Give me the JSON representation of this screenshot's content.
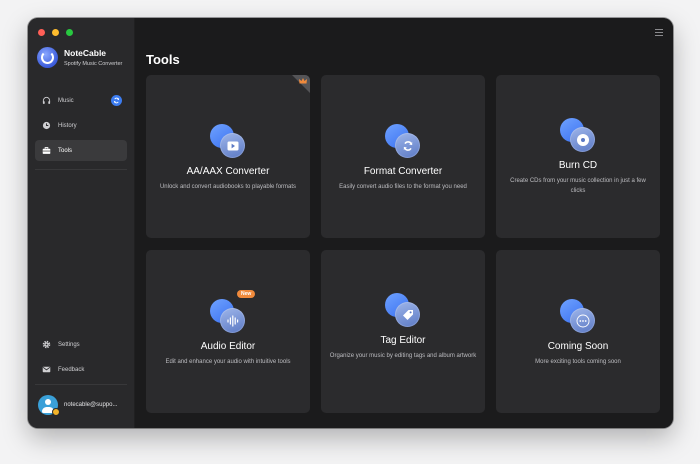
{
  "app": {
    "name": "NoteCable",
    "subtitle": "Spotify Music Converter"
  },
  "sidebar": {
    "items": [
      {
        "label": "Music",
        "icon": "headphones-icon"
      },
      {
        "label": "History",
        "icon": "clock-icon"
      },
      {
        "label": "Tools",
        "icon": "toolbox-icon",
        "active": true
      }
    ],
    "bottom_items": [
      {
        "label": "Settings",
        "icon": "gear-icon"
      },
      {
        "label": "Feedback",
        "icon": "mail-icon"
      }
    ],
    "user_email": "notecable@suppo..."
  },
  "main": {
    "title": "Tools",
    "tools": [
      {
        "title": "AA/AAX Converter",
        "desc": "Unlock and convert audiobooks to playable formats",
        "icon": "play-icon",
        "badge": "crown-icon"
      },
      {
        "title": "Format Converter",
        "desc": "Easily convert audio files to the format you need",
        "icon": "convert-icon"
      },
      {
        "title": "Burn CD",
        "desc": "Create CDs from your music collection in just a few clicks",
        "icon": "cd-icon"
      },
      {
        "title": "Audio Editor",
        "desc": "Edit and enhance your audio with intuitive tools",
        "icon": "waveform-icon",
        "badge_text": "New"
      },
      {
        "title": "Tag Editor",
        "desc": "Organize your music by editing tags and album artwork",
        "icon": "tag-icon"
      },
      {
        "title": "Coming Soon",
        "desc": "More exciting tools coming soon",
        "icon": "more-icon"
      }
    ]
  },
  "colors": {
    "accent": "#3c7cf0",
    "new_badge": "#f08a3c",
    "card_bg": "#2b2b2d",
    "window_bg": "#1b1b1c"
  }
}
